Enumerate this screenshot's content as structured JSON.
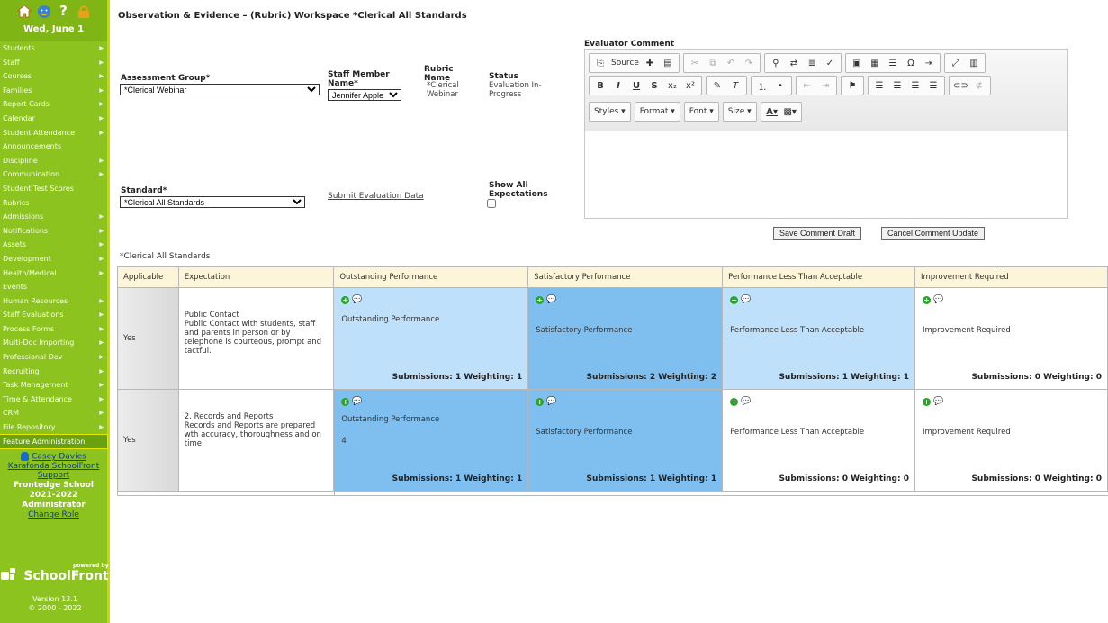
{
  "sidebar": {
    "date": "Wed, June 1",
    "top_icons": [
      "home-icon",
      "smiley-icon",
      "help-icon",
      "lock-icon"
    ],
    "items": [
      {
        "label": "Students",
        "arrow": true
      },
      {
        "label": "Staff",
        "arrow": true
      },
      {
        "label": "Courses",
        "arrow": true
      },
      {
        "label": "Families",
        "arrow": true
      },
      {
        "label": "Report Cards",
        "arrow": true
      },
      {
        "label": "Calendar",
        "arrow": true
      },
      {
        "label": "Student Attendance",
        "arrow": true
      },
      {
        "label": "Announcements",
        "arrow": false
      },
      {
        "label": "Discipline",
        "arrow": true
      },
      {
        "label": "Communication",
        "arrow": true
      },
      {
        "label": "Student Test Scores",
        "arrow": false
      },
      {
        "label": "Rubrics",
        "arrow": false
      },
      {
        "label": "Admissions",
        "arrow": true
      },
      {
        "label": "Notifications",
        "arrow": true
      },
      {
        "label": "Assets",
        "arrow": true
      },
      {
        "label": "Development",
        "arrow": true
      },
      {
        "label": "Health/Medical",
        "arrow": true
      },
      {
        "label": "Events",
        "arrow": false
      },
      {
        "label": "Human Resources",
        "arrow": true
      },
      {
        "label": "Staff Evaluations",
        "arrow": true
      },
      {
        "label": "Process Forms",
        "arrow": true
      },
      {
        "label": "Multi-Doc Importing",
        "arrow": true
      },
      {
        "label": "Professional Dev",
        "arrow": true
      },
      {
        "label": "Recruiting",
        "arrow": true
      },
      {
        "label": "Task Management",
        "arrow": true
      },
      {
        "label": "Time & Attendance",
        "arrow": true
      },
      {
        "label": "CRM",
        "arrow": true
      },
      {
        "label": "File Repository",
        "arrow": true
      },
      {
        "label": "Feature Administration",
        "arrow": false
      }
    ],
    "user": {
      "name": "Casey Davies",
      "org": "Karafonda SchoolFront",
      "support": "Support",
      "school": "Frontedge School",
      "year": "2021-2022",
      "role": "Administrator",
      "change_role": "Change Role"
    },
    "logo": {
      "powered": "powered by",
      "brand": "SchoolFront"
    },
    "version": "Version 13.1",
    "copyright": "© 2000 - 2022"
  },
  "header": {
    "title": "Observation & Evidence – (Rubric) Workspace *Clerical All Standards"
  },
  "form": {
    "assessment_group_label": "Assessment Group*",
    "assessment_group_value": "*Clerical Webinar",
    "staff_member_label_1": "Staff Member",
    "staff_member_label_2": "Name*",
    "staff_member_value": "Jennifer Apple",
    "rubric_name_label_1": "Rubric",
    "rubric_name_label_2": "Name",
    "rubric_name_value_1": "*Clerical",
    "rubric_name_value_2": "Webinar",
    "status_label": "Status",
    "status_value_1": "Evaluation In-",
    "status_value_2": "Progress",
    "standard_label": "Standard*",
    "standard_value": "*Clerical All Standards",
    "submit_link": "Submit Evaluation Data",
    "show_all_label_1": "Show All",
    "show_all_label_2": "Expectations"
  },
  "editor": {
    "label": "Evaluator Comment",
    "source_label": "Source",
    "combos": [
      "Styles",
      "Format",
      "Font",
      "Size"
    ],
    "save_draft": "Save Comment Draft",
    "cancel_update": "Cancel Comment Update"
  },
  "table": {
    "caption": "*Clerical All Standards",
    "headers": [
      "Applicable",
      "Expectation",
      "Outstanding Performance",
      "Satisfactory Performance",
      "Performance Less Than Acceptable",
      "Improvement Required"
    ],
    "rows": [
      {
        "applicable": "Yes",
        "title": "Public Contact",
        "description": "Public Contact with students, staff and parents in person or by telephone is courteous, prompt and tactful.",
        "cells": [
          {
            "label": "Outstanding Performance",
            "extra": "",
            "stats": "Submissions: 1 Weighting: 1",
            "state": "light"
          },
          {
            "label": "Satisfactory Performance",
            "extra": "",
            "stats": "Submissions: 2 Weighting: 2",
            "state": "selected"
          },
          {
            "label": "Performance Less Than Acceptable",
            "extra": "",
            "stats": "Submissions: 1 Weighting: 1",
            "state": "light"
          },
          {
            "label": "Improvement Required",
            "extra": "",
            "stats": "Submissions: 0 Weighting: 0",
            "state": "none"
          }
        ]
      },
      {
        "applicable": "Yes",
        "title": "2. Records and Reports",
        "description": "Records and Reports are prepared wth accuracy, thoroughness and on time.",
        "cells": [
          {
            "label": "Outstanding Performance",
            "extra": "4",
            "stats": "Submissions: 1 Weighting: 1",
            "state": "selected"
          },
          {
            "label": "Satisfactory Performance",
            "extra": "",
            "stats": "Submissions: 1 Weighting: 1",
            "state": "selected"
          },
          {
            "label": "Performance Less Than Acceptable",
            "extra": "",
            "stats": "Submissions: 0 Weighting: 0",
            "state": "none"
          },
          {
            "label": "Improvement Required",
            "extra": "",
            "stats": "Submissions: 0 Weighting: 0",
            "state": "none"
          }
        ]
      }
    ]
  },
  "colors": {
    "sidebar_bg": "#8dc31e",
    "selected_cell": "#7fbfef",
    "light_cell": "#bfe0fa",
    "header_bg": "#fdf5d9"
  }
}
